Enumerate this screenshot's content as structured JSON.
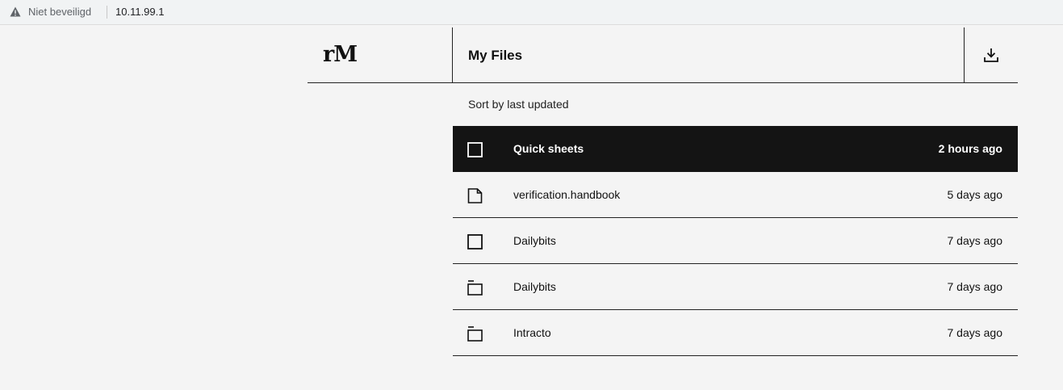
{
  "browser": {
    "security_label": "Niet beveiligd",
    "url": "10.11.99.1"
  },
  "header": {
    "logo": "rM",
    "title": "My Files"
  },
  "toolbar": {
    "sort_label": "Sort by last updated"
  },
  "files": [
    {
      "name": "Quick sheets",
      "updated": "2 hours ago",
      "icon": "notebook-icon",
      "selected": true
    },
    {
      "name": "verification.handbook",
      "updated": "5 days ago",
      "icon": "document-icon",
      "selected": false
    },
    {
      "name": "Dailybits",
      "updated": "7 days ago",
      "icon": "notebook-icon",
      "selected": false
    },
    {
      "name": "Dailybits",
      "updated": "7 days ago",
      "icon": "folder-icon",
      "selected": false
    },
    {
      "name": "Intracto",
      "updated": "7 days ago",
      "icon": "folder-icon",
      "selected": false
    }
  ]
}
